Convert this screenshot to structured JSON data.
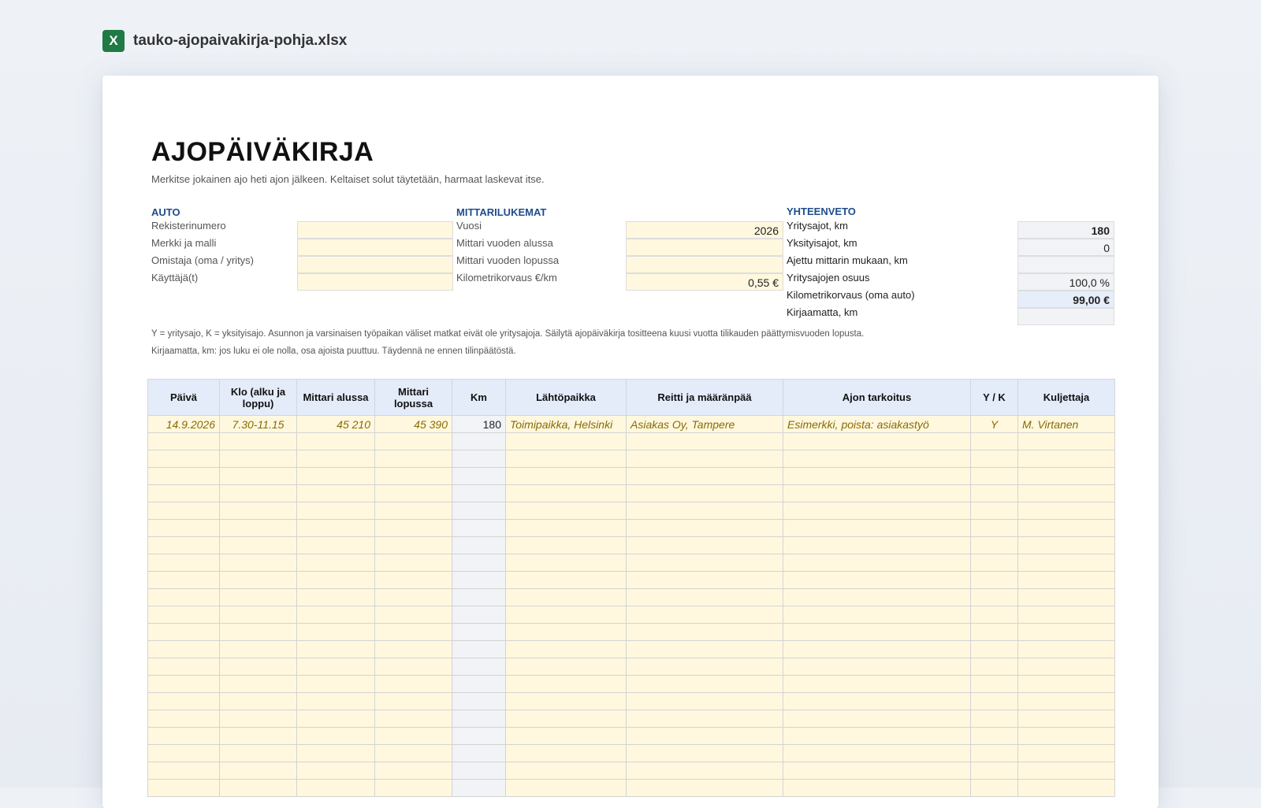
{
  "file": {
    "icon": "X",
    "name": "tauko-ajopaivakirja-pohja.xlsx"
  },
  "sheet": {
    "title": "AJOPÄIVÄKIRJA",
    "subtitle": "Merkitse jokainen ajo heti ajon jälkeen. Keltaiset solut täytetään, harmaat laskevat itse."
  },
  "auto": {
    "heading": "AUTO",
    "fields": [
      {
        "label": "Rekisterinumero",
        "value": ""
      },
      {
        "label": "Merkki ja malli",
        "value": ""
      },
      {
        "label": "Omistaja (oma / yritys)",
        "value": ""
      },
      {
        "label": "Käyttäjä(t)",
        "value": ""
      }
    ]
  },
  "mittari": {
    "heading": "MITTARILUKEMAT",
    "fields": [
      {
        "label": "Vuosi",
        "value": "2026"
      },
      {
        "label": "Mittari vuoden alussa",
        "value": ""
      },
      {
        "label": "Mittari vuoden lopussa",
        "value": ""
      },
      {
        "label": "Kilometrikorvaus €/km",
        "value": "0,55 €"
      }
    ]
  },
  "yhteenveto": {
    "heading": "YHTEENVETO",
    "fields": [
      {
        "label": "Yritysajot, km",
        "value": "180"
      },
      {
        "label": "Yksityisajot, km",
        "value": "0"
      },
      {
        "label": "Ajettu mittarin mukaan, km",
        "value": ""
      },
      {
        "label": "Yritysajojen osuus",
        "value": "100,0 %"
      },
      {
        "label": "Kilometrikorvaus (oma auto)",
        "value": "99,00 €"
      },
      {
        "label": "Kirjaamatta, km",
        "value": ""
      }
    ]
  },
  "notes": [
    "Y = yritysajo, K = yksityisajo. Asunnon ja varsinaisen työpaikan väliset matkat eivät ole yritysajoja. Säilytä ajopäiväkirja tositteena kuusi vuotta tilikauden päättymisvuoden lopusta.",
    "Kirjaamatta, km: jos luku ei ole nolla, osa ajoista puuttuu. Täydennä ne ennen tilinpäätöstä."
  ],
  "log": {
    "columns": [
      "Päivä",
      "Klo (alku ja loppu)",
      "Mittari alussa",
      "Mittari lopussa",
      "Km",
      "Lähtöpaikka",
      "Reitti ja määränpää",
      "Ajon tarkoitus",
      "Y / K",
      "Kuljettaja"
    ],
    "example": [
      "14.9.2026",
      "7.30-11.15",
      "45 210",
      "45 390",
      "180",
      "Toimipaikka, Helsinki",
      "Asiakas Oy, Tampere",
      "Esimerkki, poista: asiakastyö",
      "Y",
      "M. Virtanen"
    ],
    "empty_rows": 21
  }
}
